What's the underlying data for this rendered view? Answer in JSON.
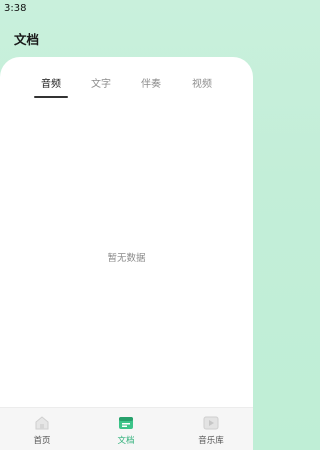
{
  "status_bar": {
    "time": "3:38"
  },
  "header": {
    "title": "文档"
  },
  "tabs": [
    {
      "label": "音频",
      "active": true
    },
    {
      "label": "文字",
      "active": false
    },
    {
      "label": "伴奏",
      "active": false
    },
    {
      "label": "视频",
      "active": false
    }
  ],
  "content": {
    "empty_message": "暂无数据"
  },
  "bottom_nav": {
    "items": [
      {
        "label": "首页",
        "icon": "home-icon",
        "active": false
      },
      {
        "label": "文档",
        "icon": "document-icon",
        "active": true
      },
      {
        "label": "音乐库",
        "icon": "music-library-icon",
        "active": false
      }
    ]
  },
  "colors": {
    "background_top": "#c9f0dc",
    "accent": "#2fb07a",
    "tab_active": "#1a1a1a",
    "tab_inactive": "#8d8d8d"
  }
}
